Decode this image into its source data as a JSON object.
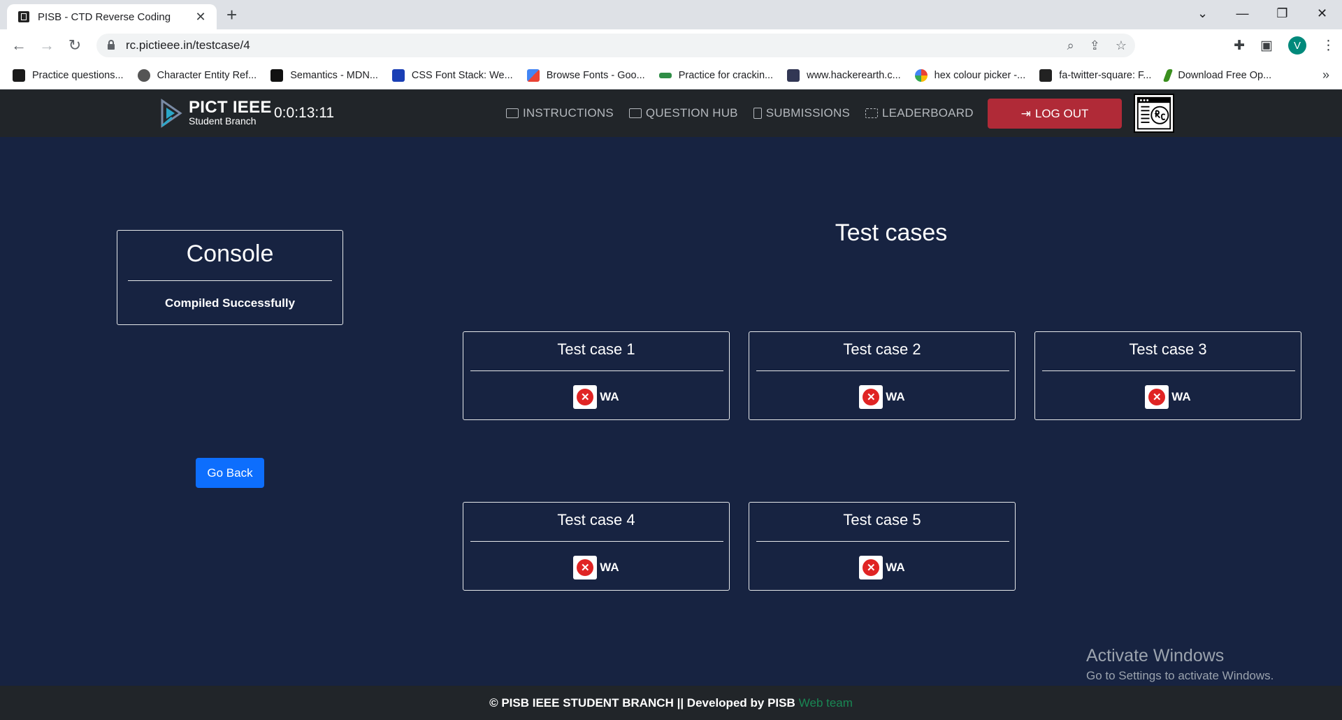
{
  "browser": {
    "tab_title": "PISB - CTD Reverse Coding",
    "url": "rc.pictieee.in/testcase/4",
    "profile_initial": "V",
    "bookmarks": [
      {
        "label": "Practice questions...",
        "color": "#1a1a1a"
      },
      {
        "label": "Character Entity Ref...",
        "color": "#555555"
      },
      {
        "label": "Semantics - MDN...",
        "color": "#111111"
      },
      {
        "label": "CSS Font Stack: We...",
        "color": "#1a3fb5"
      },
      {
        "label": "Browse Fonts - Goo...",
        "color": "#ea4335"
      },
      {
        "label": "Practice for crackin...",
        "color": "#2f8d46"
      },
      {
        "label": "www.hackerearth.c...",
        "color": "#323754"
      },
      {
        "label": "hex colour picker -...",
        "color": "#4285f4"
      },
      {
        "label": "fa-twitter-square: F...",
        "color": "#222222"
      },
      {
        "label": "Download Free Op...",
        "color": "#3a8f1e"
      }
    ]
  },
  "site": {
    "brand_line1": "PICT IEEE",
    "brand_line2": "Student Branch",
    "timer": "0:0:13:11",
    "nav": [
      {
        "label": "INSTRUCTIONS"
      },
      {
        "label": "QUESTION HUB"
      },
      {
        "label": "SUBMISSIONS"
      },
      {
        "label": "LEADERBOARD"
      }
    ],
    "logout_label": "LOG OUT"
  },
  "console": {
    "title": "Console",
    "message": "Compiled Successfully"
  },
  "go_back_label": "Go Back",
  "testcases": {
    "heading": "Test cases",
    "cases": [
      {
        "title": "Test case 1",
        "status": "WA"
      },
      {
        "title": "Test case 2",
        "status": "WA"
      },
      {
        "title": "Test case 3",
        "status": "WA"
      },
      {
        "title": "Test case 4",
        "status": "WA"
      },
      {
        "title": "Test case 5",
        "status": "WA"
      }
    ]
  },
  "watermark": {
    "line1": "Activate Windows",
    "line2": "Go to Settings to activate Windows."
  },
  "footer": {
    "text": "© PISB IEEE STUDENT BRANCH || Developed by PISB",
    "link": "Web team"
  },
  "colors": {
    "page_bg": "#172341",
    "nav_bg": "#212529",
    "logout_bg": "#b02a37",
    "go_back_bg": "#0d6efd",
    "error_red": "#e02424",
    "footer_link": "#198754"
  }
}
